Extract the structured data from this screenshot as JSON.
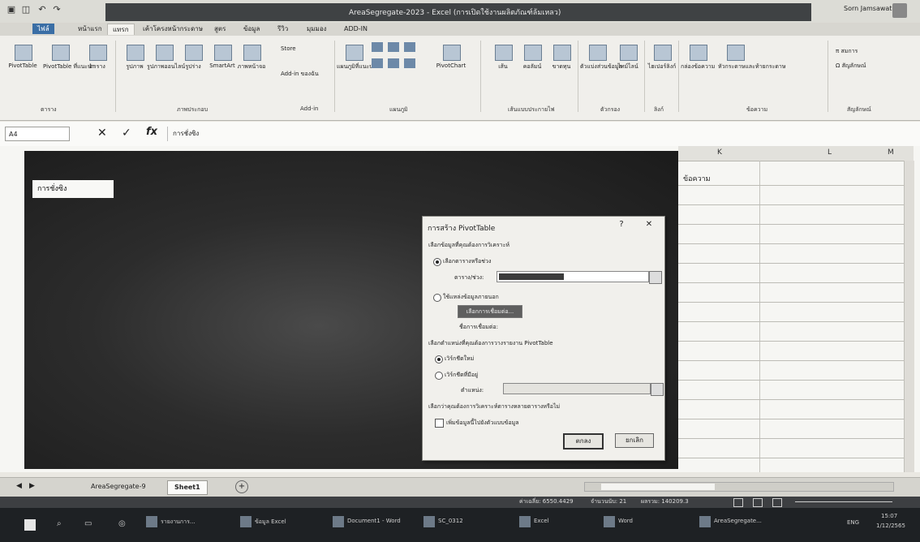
{
  "window": {
    "title": "AreaSegregate-2023 - Excel (การเปิดใช้งานผลิตภัณฑ์ล้มเหลว)",
    "user": "Sorn Jamsawat"
  },
  "tabs": [
    "ไฟล์",
    "หน้าแรก",
    "แทรก",
    "เค้าโครงหน้ากระดาษ",
    "สูตร",
    "ข้อมูล",
    "รีวิว",
    "มุมมอง",
    "ADD-IN"
  ],
  "active_tab_index": 2,
  "ribbon": {
    "buttons": [
      {
        "label": "PivotTable",
        "icon": "pivottable-icon"
      },
      {
        "label": "PivotTable ที่แนะนำ",
        "icon": "recommended-pivot-icon"
      },
      {
        "label": "ตาราง",
        "icon": "table-icon"
      },
      {
        "label": "รูปภาพ",
        "icon": "picture-icon"
      },
      {
        "label": "รูปภาพออนไลน์",
        "icon": "online-picture-icon"
      },
      {
        "label": "รูปร่าง",
        "icon": "shapes-icon"
      },
      {
        "label": "SmartArt",
        "icon": "smartart-icon"
      },
      {
        "label": "ภาพหน้าจอ",
        "icon": "screenshot-icon"
      },
      {
        "label": "แผนภูมิที่แนะนำ",
        "icon": "recommended-chart-icon"
      },
      {
        "label": "PivotChart",
        "icon": "pivotchart-icon"
      },
      {
        "label": "เส้น",
        "icon": "sparkline-line-icon"
      },
      {
        "label": "คอลัมน์",
        "icon": "sparkline-column-icon"
      },
      {
        "label": "ขาดทุน",
        "icon": "sparkline-winloss-icon"
      },
      {
        "label": "ตัวแบ่งส่วนข้อมูล",
        "icon": "slicer-icon"
      },
      {
        "label": "ไทม์ไลน์",
        "icon": "timeline-icon"
      },
      {
        "label": "ไฮเปอร์ลิงก์",
        "icon": "hyperlink-icon"
      },
      {
        "label": "กล่องข้อความ",
        "icon": "textbox-icon"
      },
      {
        "label": "หัวกระดาษและท้ายกระดาษ",
        "icon": "header-footer-icon"
      }
    ],
    "groups": [
      "ตาราง",
      "ภาพประกอบ",
      "Add-in",
      "แผนภูมิ",
      "เส้นแบบประกายไฟ",
      "ตัวกรอง",
      "ลิงก์",
      "ข้อความ",
      "สัญลักษณ์"
    ],
    "addins": {
      "store": "Store",
      "my_addins": "Add-in ของฉัน"
    },
    "symbols": {
      "equation": "π สมการ",
      "symbol": "Ω สัญลักษณ์"
    }
  },
  "formula_bar": {
    "name_box": "A4",
    "cancel": "✕",
    "enter": "✓",
    "fx": "fx",
    "content": "การชั่งซิง"
  },
  "sheet": {
    "chip_text": "การชั่งซิง",
    "column_headers": [
      "K",
      "L",
      "M"
    ],
    "cell_text": "ข้อความ"
  },
  "dialog": {
    "title": "การสร้าง PivotTable",
    "help": "?",
    "close": "✕",
    "section1": "เลือกข้อมูลที่คุณต้องการวิเคราะห์",
    "option_select_table": "เลือกตารางหรือช่วง",
    "range_label": "ตาราง/ช่วง:",
    "option_external": "ใช้แหล่งข้อมูลภายนอก",
    "choose_connection": "เลือกการเชื่อมต่อ...",
    "connection_name": "ชื่อการเชื่อมต่อ:",
    "section2": "เลือกตำแหน่งที่คุณต้องการวางรายงาน PivotTable",
    "option_new_sheet": "เวิร์กชีตใหม่",
    "option_existing_sheet": "เวิร์กชีตที่มีอยู่",
    "location_label": "ตำแหน่ง:",
    "section3": "เลือกว่าคุณต้องการวิเคราะห์ตารางหลายตารางหรือไม่",
    "add_to_data_model": "เพิ่มข้อมูลนี้ไปยังตัวแบบข้อมูล",
    "ok": "ตกลง",
    "cancel": "ยกเลิก"
  },
  "sheet_tabs": [
    "AreaSegregate-9",
    "Sheet1"
  ],
  "active_sheet_index": 1,
  "status": {
    "average": "ค่าเฉลี่ย: 6550.4429",
    "count": "จำนวนนับ: 21",
    "sum": "ผลรวม: 140209.3"
  },
  "taskbar": {
    "items": [
      "รายงานการ...",
      "ข้อมูล Excel",
      "Document1 - Word",
      "SC_0312",
      "Excel",
      "Word",
      "AreaSegregate..."
    ],
    "tray": "ENG",
    "time": "15:07",
    "date": "1/12/2565"
  }
}
